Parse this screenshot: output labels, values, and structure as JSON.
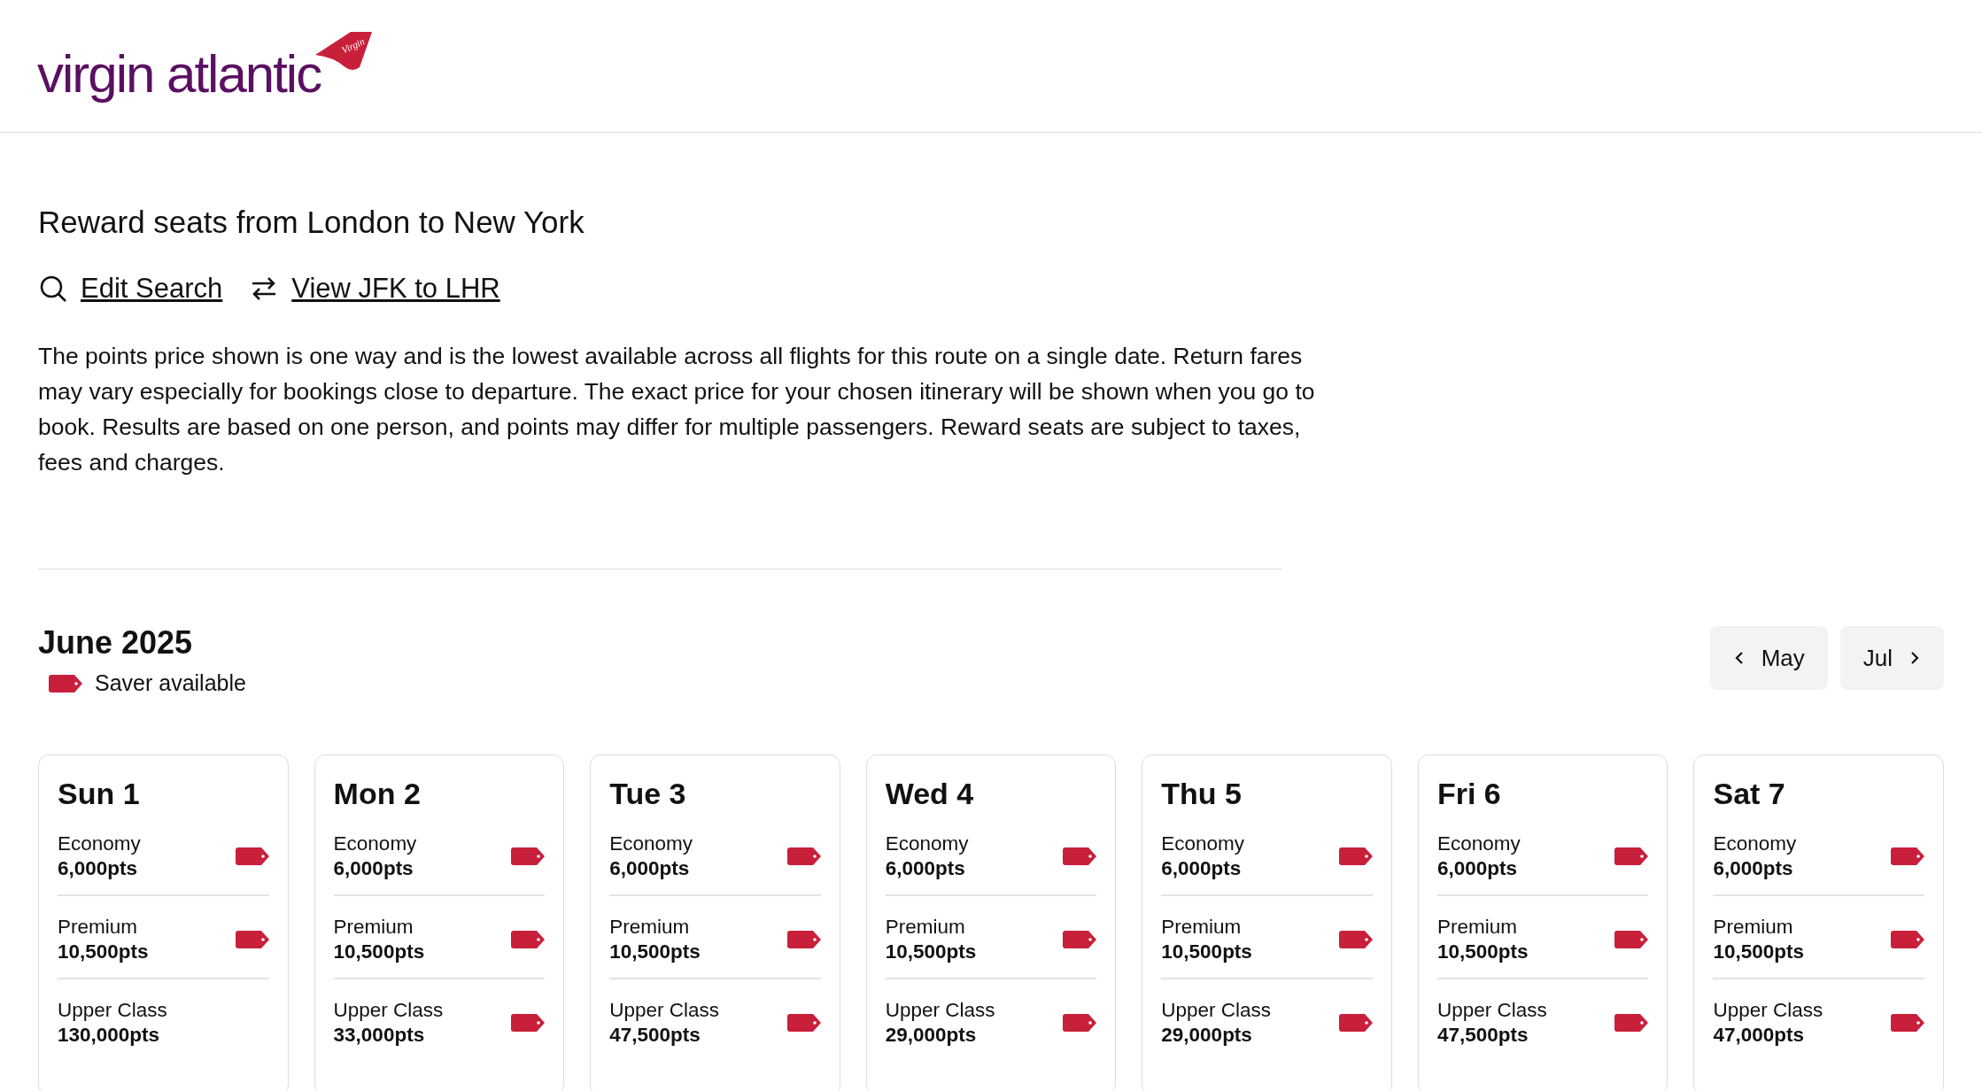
{
  "header": {
    "logo": {
      "wordmark": "virgin atlantic",
      "tail_text": "Virgin"
    }
  },
  "title": "Reward seats from London to New York",
  "links": [
    {
      "kind": "search",
      "label": "Edit Search"
    },
    {
      "kind": "swap",
      "label": "View JFK to LHR"
    }
  ],
  "disclaimer": "The points price shown is one way and is the lowest available across all flights for this route on a single date. Return fares may vary especially for bookings close to departure. The exact price for your chosen itinerary will be shown when you go to book. Results are based on one person, and points may differ for multiple passengers. Reward seats are subject to taxes, fees and charges.",
  "calendar": {
    "month": "June 2025",
    "legend": "Saver available",
    "prev": "May",
    "next": "Jul",
    "days": [
      {
        "day": "Sun 1",
        "fares": [
          {
            "cabin": "Economy",
            "points": "6,000pts",
            "saver": true
          },
          {
            "cabin": "Premium",
            "points": "10,500pts",
            "saver": true
          },
          {
            "cabin": "Upper Class",
            "points": "130,000pts",
            "saver": false
          }
        ]
      },
      {
        "day": "Mon 2",
        "fares": [
          {
            "cabin": "Economy",
            "points": "6,000pts",
            "saver": true
          },
          {
            "cabin": "Premium",
            "points": "10,500pts",
            "saver": true
          },
          {
            "cabin": "Upper Class",
            "points": "33,000pts",
            "saver": true
          }
        ]
      },
      {
        "day": "Tue 3",
        "fares": [
          {
            "cabin": "Economy",
            "points": "6,000pts",
            "saver": true
          },
          {
            "cabin": "Premium",
            "points": "10,500pts",
            "saver": true
          },
          {
            "cabin": "Upper Class",
            "points": "47,500pts",
            "saver": true
          }
        ]
      },
      {
        "day": "Wed 4",
        "fares": [
          {
            "cabin": "Economy",
            "points": "6,000pts",
            "saver": true
          },
          {
            "cabin": "Premium",
            "points": "10,500pts",
            "saver": true
          },
          {
            "cabin": "Upper Class",
            "points": "29,000pts",
            "saver": true
          }
        ]
      },
      {
        "day": "Thu 5",
        "fares": [
          {
            "cabin": "Economy",
            "points": "6,000pts",
            "saver": true
          },
          {
            "cabin": "Premium",
            "points": "10,500pts",
            "saver": true
          },
          {
            "cabin": "Upper Class",
            "points": "29,000pts",
            "saver": true
          }
        ]
      },
      {
        "day": "Fri 6",
        "fares": [
          {
            "cabin": "Economy",
            "points": "6,000pts",
            "saver": true
          },
          {
            "cabin": "Premium",
            "points": "10,500pts",
            "saver": true
          },
          {
            "cabin": "Upper Class",
            "points": "47,500pts",
            "saver": true
          }
        ]
      },
      {
        "day": "Sat 7",
        "fares": [
          {
            "cabin": "Economy",
            "points": "6,000pts",
            "saver": true
          },
          {
            "cabin": "Premium",
            "points": "10,500pts",
            "saver": true
          },
          {
            "cabin": "Upper Class",
            "points": "47,000pts",
            "saver": true
          }
        ]
      }
    ]
  }
}
